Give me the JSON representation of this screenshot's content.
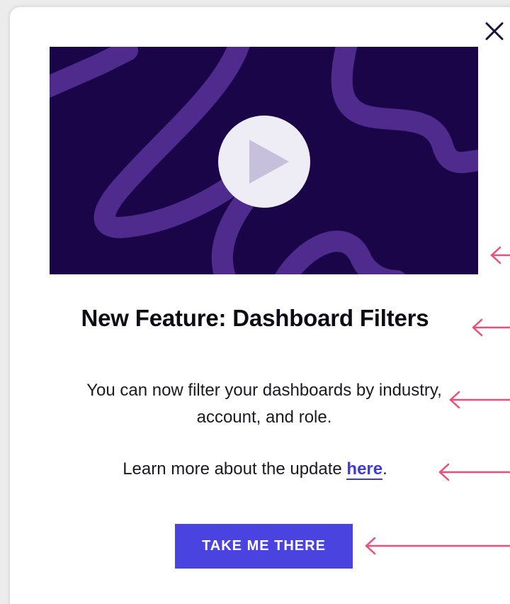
{
  "modal": {
    "close_icon": "close-icon",
    "video": {
      "play_icon": "play-icon",
      "background_color": "#1a0549",
      "squiggle_color": "#4e2b8c"
    },
    "title": "New Feature: Dashboard Filters",
    "description": "You can now filter your dashboards by industry, account, and role.",
    "learn_more_prefix": "Learn more about the update ",
    "learn_more_link": "here",
    "learn_more_suffix": ".",
    "cta_label": "TAKE ME THERE"
  },
  "annotations": {
    "arrow_icon": "left-arrow-icon",
    "arrow_color": "#ef4c79"
  },
  "colors": {
    "accent": "#4a43e0",
    "link": "#3f3ad8"
  }
}
